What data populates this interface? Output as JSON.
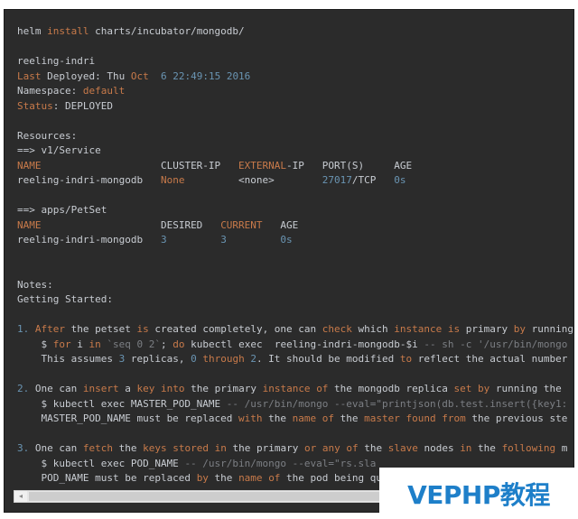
{
  "terminal": {
    "lines": [
      {
        "segments": [
          {
            "t": "helm "
          },
          {
            "t": "install",
            "c": "kw"
          },
          {
            "t": " charts/incubator/mongodb/"
          }
        ]
      },
      {
        "segments": []
      },
      {
        "segments": [
          {
            "t": "reeling-indri"
          }
        ]
      },
      {
        "segments": [
          {
            "t": "Last",
            "c": "kw"
          },
          {
            "t": " Deployed: Thu "
          },
          {
            "t": "Oct",
            "c": "kw"
          },
          {
            "t": "  "
          },
          {
            "t": "6 22:49:15 2016",
            "c": "num"
          }
        ]
      },
      {
        "segments": [
          {
            "t": "Namespace: "
          },
          {
            "t": "default",
            "c": "kw"
          }
        ]
      },
      {
        "segments": [
          {
            "t": "Status",
            "c": "kw"
          },
          {
            "t": ": DEPLOYED"
          }
        ]
      },
      {
        "segments": []
      },
      {
        "segments": [
          {
            "t": "Resources:"
          }
        ]
      },
      {
        "segments": [
          {
            "t": "==> v1/Service"
          }
        ]
      },
      {
        "segments": [
          {
            "t": "NAME",
            "c": "kw"
          },
          {
            "t": "                    CLUSTER-IP   "
          },
          {
            "t": "EXTERNAL",
            "c": "kw"
          },
          {
            "t": "-IP   PORT(S)     AGE"
          }
        ]
      },
      {
        "segments": [
          {
            "t": "reeling-indri-mongodb   "
          },
          {
            "t": "None",
            "c": "kw"
          },
          {
            "t": "         <none>        "
          },
          {
            "t": "27017",
            "c": "num"
          },
          {
            "t": "/TCP   "
          },
          {
            "t": "0s",
            "c": "num"
          }
        ]
      },
      {
        "segments": []
      },
      {
        "segments": [
          {
            "t": "==> apps/PetSet"
          }
        ]
      },
      {
        "segments": [
          {
            "t": "NAME",
            "c": "kw"
          },
          {
            "t": "                    DESIRED   "
          },
          {
            "t": "CURRENT",
            "c": "kw"
          },
          {
            "t": "   AGE"
          }
        ]
      },
      {
        "segments": [
          {
            "t": "reeling-indri-mongodb   "
          },
          {
            "t": "3",
            "c": "num"
          },
          {
            "t": "         "
          },
          {
            "t": "3",
            "c": "num"
          },
          {
            "t": "         "
          },
          {
            "t": "0s",
            "c": "num"
          }
        ]
      },
      {
        "segments": []
      },
      {
        "segments": []
      },
      {
        "segments": [
          {
            "t": "Notes:"
          }
        ]
      },
      {
        "segments": [
          {
            "t": "Getting Started:"
          }
        ]
      },
      {
        "segments": []
      },
      {
        "segments": [
          {
            "t": "1. ",
            "c": "num"
          },
          {
            "t": "After",
            "c": "kw"
          },
          {
            "t": " the petset "
          },
          {
            "t": "is",
            "c": "kw"
          },
          {
            "t": " created completely, one can "
          },
          {
            "t": "check",
            "c": "kw"
          },
          {
            "t": " which "
          },
          {
            "t": "instance",
            "c": "kw"
          },
          {
            "t": " "
          },
          {
            "t": "is",
            "c": "kw"
          },
          {
            "t": " primary "
          },
          {
            "t": "by",
            "c": "kw"
          },
          {
            "t": " running the following command"
          }
        ]
      },
      {
        "segments": [
          {
            "t": "    $ "
          },
          {
            "t": "for",
            "c": "kw"
          },
          {
            "t": " i "
          },
          {
            "t": "in",
            "c": "kw"
          },
          {
            "t": " "
          },
          {
            "t": "`seq 0 2`",
            "c": "dim"
          },
          {
            "t": "; "
          },
          {
            "t": "do",
            "c": "kw"
          },
          {
            "t": " kubectl exec  reeling-indri-mongodb-$i "
          },
          {
            "t": "-- sh -c '/usr/bin/mongo",
            "c": "dim"
          }
        ]
      },
      {
        "segments": [
          {
            "t": "    This assumes "
          },
          {
            "t": "3",
            "c": "num"
          },
          {
            "t": " replicas, "
          },
          {
            "t": "0",
            "c": "num"
          },
          {
            "t": " "
          },
          {
            "t": "through",
            "c": "kw"
          },
          {
            "t": " "
          },
          {
            "t": "2",
            "c": "num"
          },
          {
            "t": ". It should be modified "
          },
          {
            "t": "to",
            "c": "kw"
          },
          {
            "t": " reflect the actual number"
          }
        ]
      },
      {
        "segments": []
      },
      {
        "segments": [
          {
            "t": "2. ",
            "c": "num"
          },
          {
            "t": "One can "
          },
          {
            "t": "insert",
            "c": "kw"
          },
          {
            "t": " a "
          },
          {
            "t": "key",
            "c": "kw"
          },
          {
            "t": " "
          },
          {
            "t": "into",
            "c": "kw"
          },
          {
            "t": " the primary "
          },
          {
            "t": "instance",
            "c": "kw"
          },
          {
            "t": " "
          },
          {
            "t": "of",
            "c": "kw"
          },
          {
            "t": " the mongodb replica "
          },
          {
            "t": "set",
            "c": "kw"
          },
          {
            "t": " "
          },
          {
            "t": "by",
            "c": "kw"
          },
          {
            "t": " running the"
          }
        ]
      },
      {
        "segments": [
          {
            "t": "    $ kubectl exec MASTER_POD_NAME "
          },
          {
            "t": "-- /usr/bin/mongo --eval=\"printjson(db.test.insert({key1:",
            "c": "dim"
          }
        ]
      },
      {
        "segments": [
          {
            "t": "    MASTER_POD_NAME must be replaced "
          },
          {
            "t": "with",
            "c": "kw"
          },
          {
            "t": " the "
          },
          {
            "t": "name",
            "c": "kw"
          },
          {
            "t": " "
          },
          {
            "t": "of",
            "c": "kw"
          },
          {
            "t": " the "
          },
          {
            "t": "master",
            "c": "kw"
          },
          {
            "t": " "
          },
          {
            "t": "found",
            "c": "kw"
          },
          {
            "t": " "
          },
          {
            "t": "from",
            "c": "kw"
          },
          {
            "t": " the previous ste"
          }
        ]
      },
      {
        "segments": []
      },
      {
        "segments": [
          {
            "t": "3. ",
            "c": "num"
          },
          {
            "t": "One can "
          },
          {
            "t": "fetch",
            "c": "kw"
          },
          {
            "t": " the "
          },
          {
            "t": "keys",
            "c": "kw"
          },
          {
            "t": " "
          },
          {
            "t": "stored",
            "c": "kw"
          },
          {
            "t": " "
          },
          {
            "t": "in",
            "c": "kw"
          },
          {
            "t": " the primary "
          },
          {
            "t": "or",
            "c": "kw"
          },
          {
            "t": " "
          },
          {
            "t": "any",
            "c": "kw"
          },
          {
            "t": " "
          },
          {
            "t": "of",
            "c": "kw"
          },
          {
            "t": " the "
          },
          {
            "t": "slave",
            "c": "kw"
          },
          {
            "t": " nodes "
          },
          {
            "t": "in",
            "c": "kw"
          },
          {
            "t": " the "
          },
          {
            "t": "following",
            "c": "kw"
          },
          {
            "t": " m"
          }
        ]
      },
      {
        "segments": [
          {
            "t": "    $ kubectl exec POD_NAME "
          },
          {
            "t": "-- /usr/bin/mongo --eval=\"rs.sla",
            "c": "dim"
          }
        ]
      },
      {
        "segments": [
          {
            "t": "    POD_NAME must be replaced "
          },
          {
            "t": "by",
            "c": "kw"
          },
          {
            "t": " the "
          },
          {
            "t": "name",
            "c": "kw"
          },
          {
            "t": " "
          },
          {
            "t": "of",
            "c": "kw"
          },
          {
            "t": " the pod being qu"
          }
        ]
      }
    ]
  },
  "scrollbar": {
    "left_arrow": "◂"
  },
  "watermark": {
    "text": "VEPHP教程"
  },
  "colors": {
    "background": "#2b2b2b",
    "text": "#c8ccd2",
    "keyword": "#c87a4a",
    "number": "#6a95b3",
    "watermark": "#1e7fc9"
  }
}
